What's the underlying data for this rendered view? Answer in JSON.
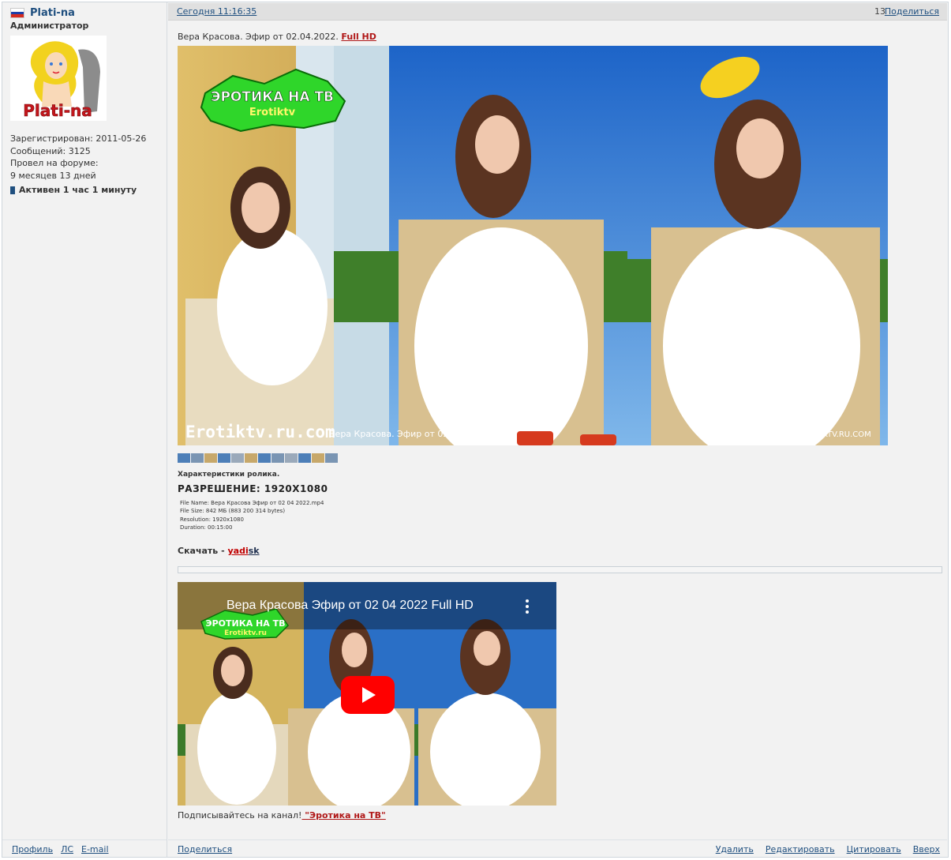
{
  "user": {
    "name": "Plati-na",
    "role": "Администратор",
    "avatar_text": "Plati-na",
    "registered": "Зарегистрирован: 2011-05-26",
    "messages": "Сообщений: 3125",
    "time_on_forum_label": "Провел на форуме:",
    "time_on_forum_value": "9 месяцев 13 дней",
    "active": "Активен 1 час 1 минуту"
  },
  "header": {
    "date": "Сегодня 11:16:35",
    "post_number": "13",
    "share": "Поделиться"
  },
  "post": {
    "title_text": "Вера Красова. Эфир от 02.04.2022. ",
    "title_link": "Full HD",
    "image": {
      "logo_line1": "ЭРОТИКА НА ТВ",
      "logo_line2": "Erotiktv",
      "watermark_site": "Erotiktv.ru.com",
      "watermark_caption": "Вера Красова. Эфир от 02.04.2022",
      "watermark_right": "EROTIKTV.RU.COM"
    },
    "characteristics": "Характеристики ролика.",
    "resolution": "РАЗРЕШЕНИЕ: 1920Х1080",
    "spec": {
      "file_name": "File Name: Вера Красова Эфир от 02 04 2022.mp4",
      "file_size": "File Size: 842 МБ (883 200 314 bytes)",
      "resolution": "Resolution: 1920x1080",
      "duration": "Duration: 00:15:00"
    },
    "download_label": "Скачать - ",
    "download_link_a": "yadi",
    "download_link_b": "sk",
    "video": {
      "title": "Вера Красова Эфир от 02 04 2022 Full HD",
      "logo_line1": "ЭРОТИКА НА ТВ",
      "logo_line2": "Erotiktv.ru"
    },
    "subscribe_text": "Подписывайтесь на канал!",
    "subscribe_link": " \"Эротика на ТВ\""
  },
  "footer": {
    "profile": "Профиль",
    "pm": "ЛС",
    "email": "E-mail",
    "share": "Поделиться",
    "delete": "Удалить",
    "edit": "Редактировать",
    "quote": "Цитировать",
    "top": "Вверх"
  },
  "colors": {
    "link": "#1f4f7f",
    "accent_red": "#b01818",
    "header_bg": "#e0e0e0",
    "panel_bg": "#f2f2f2",
    "youtube_red": "#ff0000"
  }
}
